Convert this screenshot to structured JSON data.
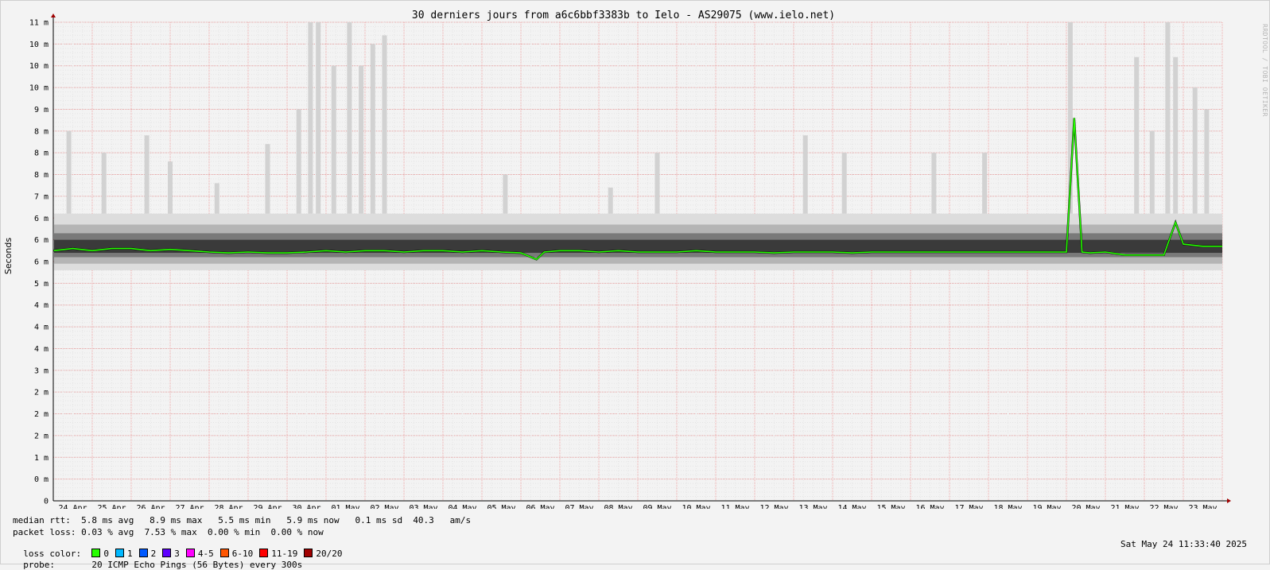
{
  "chart_data": {
    "type": "area",
    "title": "30 derniers jours from a6c6bbf3383b to Ielo - AS29075 (www.ielo.net)",
    "ylabel": "Seconds",
    "xlabel": "",
    "ylim": [
      0,
      11
    ],
    "grid": true,
    "y_ticks": [
      {
        "value": 0,
        "label": "0"
      },
      {
        "value": 0.5,
        "label": "0 m"
      },
      {
        "value": 1,
        "label": "1 m"
      },
      {
        "value": 1.5,
        "label": "2 m"
      },
      {
        "value": 2,
        "label": "2 m"
      },
      {
        "value": 2.5,
        "label": "2 m"
      },
      {
        "value": 3,
        "label": "3 m"
      },
      {
        "value": 3.5,
        "label": "4 m"
      },
      {
        "value": 4,
        "label": "4 m"
      },
      {
        "value": 4.5,
        "label": "4 m"
      },
      {
        "value": 5,
        "label": "5 m"
      },
      {
        "value": 5.5,
        "label": "6 m"
      },
      {
        "value": 6,
        "label": "6 m"
      },
      {
        "value": 6.5,
        "label": "6 m"
      },
      {
        "value": 7,
        "label": "7 m"
      },
      {
        "value": 7.5,
        "label": "8 m"
      },
      {
        "value": 8,
        "label": "8 m"
      },
      {
        "value": 8.5,
        "label": "8 m"
      },
      {
        "value": 9,
        "label": "9 m"
      },
      {
        "value": 9.5,
        "label": "10 m"
      },
      {
        "value": 10,
        "label": "10 m"
      },
      {
        "value": 10.5,
        "label": "10 m"
      },
      {
        "value": 11,
        "label": "11 m"
      }
    ],
    "x_labels": [
      "24 Apr",
      "25 Apr",
      "26 Apr",
      "27 Apr",
      "28 Apr",
      "29 Apr",
      "30 Apr",
      "01 May",
      "02 May",
      "03 May",
      "04 May",
      "05 May",
      "06 May",
      "07 May",
      "08 May",
      "09 May",
      "10 May",
      "11 May",
      "12 May",
      "13 May",
      "14 May",
      "15 May",
      "16 May",
      "17 May",
      "18 May",
      "19 May",
      "20 May",
      "21 May",
      "22 May",
      "23 May"
    ],
    "x_range_days": [
      0,
      30
    ],
    "median_series": {
      "name": "median rtt",
      "x_days": [
        0,
        0.5,
        1,
        1.5,
        2,
        2.5,
        3,
        3.5,
        4,
        4.5,
        5,
        5.5,
        6,
        6.5,
        7,
        7.5,
        8,
        8.5,
        9,
        9.5,
        10,
        10.5,
        11,
        11.5,
        12,
        12.4,
        12.6,
        13,
        13.5,
        14,
        14.5,
        15,
        15.5,
        16,
        16.5,
        17,
        17.5,
        18,
        18.5,
        19,
        19.5,
        20,
        20.5,
        21,
        21.5,
        22,
        22.5,
        23,
        23.5,
        24,
        24.5,
        25,
        25.5,
        26,
        26.2,
        26.4,
        26.6,
        27,
        27.5,
        28,
        28.5,
        28.8,
        29,
        29.5,
        30
      ],
      "values": [
        5.75,
        5.8,
        5.75,
        5.8,
        5.8,
        5.75,
        5.78,
        5.75,
        5.72,
        5.7,
        5.72,
        5.7,
        5.7,
        5.72,
        5.75,
        5.72,
        5.75,
        5.75,
        5.72,
        5.75,
        5.75,
        5.72,
        5.75,
        5.72,
        5.7,
        5.55,
        5.72,
        5.75,
        5.75,
        5.72,
        5.75,
        5.72,
        5.72,
        5.72,
        5.75,
        5.72,
        5.72,
        5.72,
        5.7,
        5.72,
        5.72,
        5.72,
        5.7,
        5.72,
        5.72,
        5.72,
        5.72,
        5.72,
        5.72,
        5.72,
        5.72,
        5.72,
        5.72,
        5.72,
        8.8,
        5.72,
        5.7,
        5.72,
        5.65,
        5.65,
        5.65,
        6.4,
        5.9,
        5.85,
        5.85
      ]
    },
    "spike_series": {
      "name": "max rtt",
      "x_days": [
        0.4,
        1.3,
        2.4,
        3.0,
        4.2,
        5.5,
        6.3,
        6.6,
        6.8,
        7.2,
        7.6,
        7.9,
        8.2,
        8.5,
        11.6,
        14.3,
        15.5,
        19.3,
        20.3,
        22.6,
        23.9,
        26.1,
        27.8,
        28.2,
        28.6,
        28.8,
        29.3,
        29.6
      ],
      "values": [
        8.5,
        8.0,
        8.4,
        7.8,
        7.3,
        8.2,
        9.0,
        11.0,
        11.0,
        10.0,
        11.0,
        10.0,
        10.5,
        10.7,
        7.5,
        7.2,
        8.0,
        8.4,
        8.0,
        8.0,
        8.0,
        11.0,
        10.2,
        8.5,
        11.0,
        10.2,
        9.5,
        9.0
      ]
    },
    "smoke_band": {
      "low": 5.3,
      "high": 6.6
    },
    "legend": {
      "median_rtt": "median rtt:  5.8 ms avg   8.9 ms max   5.5 ms min   5.9 ms now   0.1 ms sd  40.3   am/s",
      "packet_loss": "packet loss: 0.03 % avg  7.53 % max  0.00 % min  0.00 % now",
      "loss_color_label": "loss color:",
      "loss_colors": [
        {
          "label": "0",
          "color": "#26ff00"
        },
        {
          "label": "1",
          "color": "#00b8ff"
        },
        {
          "label": "2",
          "color": "#0059ff"
        },
        {
          "label": "3",
          "color": "#5e00ff"
        },
        {
          "label": "4-5",
          "color": "#ff00ff"
        },
        {
          "label": "6-10",
          "color": "#ff5500"
        },
        {
          "label": "11-19",
          "color": "#ff0000"
        },
        {
          "label": "20/20",
          "color": "#a10000"
        }
      ],
      "probe_label": "probe:",
      "probe_text": "20 ICMP Echo Pings (56 Bytes) every 300s"
    },
    "timestamp": "Sat May 24 11:33:40 2025",
    "watermark": "RRDTOOL / TOBI OETIKER"
  }
}
